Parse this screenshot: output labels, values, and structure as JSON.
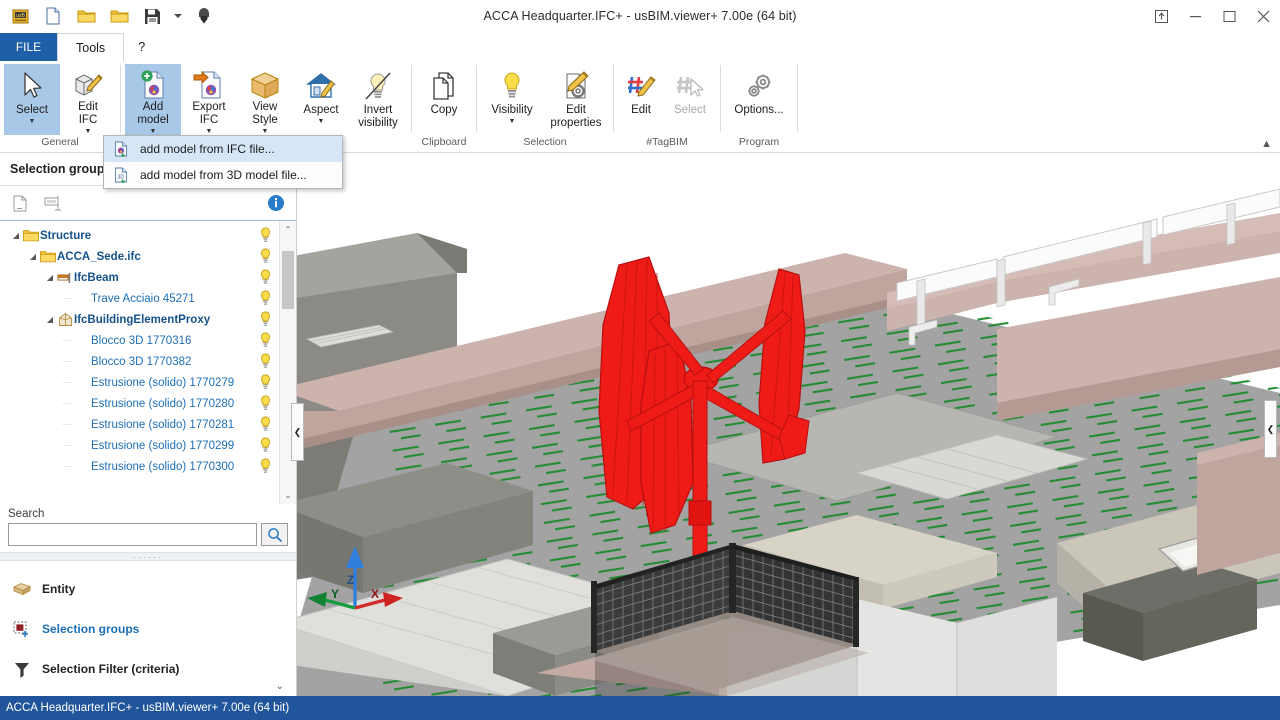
{
  "window": {
    "title": "ACCA Headquarter.IFC+ - usBIM.viewer+  7.00e (64 bit)",
    "restore_label": "❐",
    "minimize_label": "–",
    "maximize_label": "❐",
    "close_label": "✕"
  },
  "quick_access": [
    {
      "name": "app-logo-icon",
      "label": "usBIM"
    },
    {
      "name": "new-file-icon",
      "label": "New"
    },
    {
      "name": "open-folder-icon",
      "label": "Open"
    },
    {
      "name": "recent-folder-icon",
      "label": "Recent"
    },
    {
      "name": "save-icon",
      "label": "Save"
    },
    {
      "name": "save-dropdown-icon",
      "label": "▾"
    },
    {
      "name": "download-icon",
      "label": "Download"
    }
  ],
  "tabs": {
    "file": "FILE",
    "items": [
      {
        "label": "Tools",
        "active": true
      },
      {
        "label": "?",
        "active": false
      }
    ]
  },
  "ribbon": {
    "collapse_label": "▲",
    "groups": [
      {
        "label": "General",
        "buttons": [
          {
            "name": "select-button",
            "label": "Select",
            "icon": "cursor-arrow-icon",
            "caret": true,
            "state": "selected"
          },
          {
            "name": "edit-ifc-button",
            "label": "Edit\nIFC",
            "icon": "edit-ifc-icon",
            "caret": true,
            "state": "normal"
          }
        ]
      },
      {
        "label": "",
        "buttons": [
          {
            "name": "add-model-button",
            "label": "Add\nmodel",
            "icon": "add-model-icon",
            "caret": true,
            "state": "highlighted"
          },
          {
            "name": "export-ifc-button",
            "label": "Export\nIFC",
            "icon": "export-ifc-icon",
            "caret": true,
            "state": "normal"
          },
          {
            "name": "view-style-button",
            "label": "View\nStyle",
            "icon": "cube-icon",
            "caret": true,
            "state": "normal"
          },
          {
            "name": "aspect-button",
            "label": "Aspect",
            "icon": "house-brush-icon",
            "caret": true,
            "state": "normal"
          },
          {
            "name": "invert-visibility-button",
            "label": "Invert\nvisibility",
            "icon": "bulb-crossed-icon",
            "caret": false,
            "state": "normal"
          }
        ]
      },
      {
        "label": "Clipboard",
        "buttons": [
          {
            "name": "copy-button",
            "label": "Copy",
            "icon": "copy-pages-icon",
            "caret": false,
            "state": "normal"
          }
        ]
      },
      {
        "label": "Selection",
        "buttons": [
          {
            "name": "visibility-button",
            "label": "Visibility",
            "icon": "bulb-icon",
            "caret": true,
            "state": "normal"
          },
          {
            "name": "edit-properties-button",
            "label": "Edit\nproperties",
            "icon": "edit-properties-icon",
            "caret": false,
            "state": "normal"
          }
        ]
      },
      {
        "label": "#TagBIM",
        "buttons": [
          {
            "name": "tag-edit-button",
            "label": "Edit",
            "icon": "hash-pencil-icon",
            "caret": false,
            "state": "normal"
          },
          {
            "name": "tag-select-button",
            "label": "Select",
            "icon": "hash-cursor-icon",
            "caret": false,
            "state": "disabled"
          }
        ]
      },
      {
        "label": "Program",
        "buttons": [
          {
            "name": "options-button",
            "label": "Options...",
            "icon": "gears-icon",
            "caret": false,
            "state": "normal"
          }
        ]
      }
    ]
  },
  "add_model_menu": {
    "items": [
      {
        "name": "menu-add-model-from-ifc",
        "label": "add model from IFC file...",
        "icon": "ifc-file-icon",
        "hovered": true
      },
      {
        "name": "menu-add-model-from-3d",
        "label": "add model from 3D model file...",
        "icon": "model3d-file-icon",
        "hovered": false
      }
    ]
  },
  "left_panel": {
    "title": "Selection groups",
    "toolbar": [
      {
        "name": "new-group-icon",
        "label": "New group"
      },
      {
        "name": "rename-group-icon",
        "label": "Rename group"
      },
      {
        "name": "info-icon",
        "label": "Info"
      }
    ],
    "tree": [
      {
        "label": "Structure",
        "indent": 0,
        "icon": "folder-icon",
        "bold": true,
        "expander": "collapse",
        "bulb": true
      },
      {
        "label": "ACCA_Sede.ifc",
        "indent": 1,
        "icon": "folder-icon",
        "bold": true,
        "expander": "collapse",
        "bulb": true
      },
      {
        "label": "IfcBeam",
        "indent": 2,
        "icon": "beam-icon",
        "bold": true,
        "expander": "collapse",
        "bulb": true
      },
      {
        "label": "Trave Acciaio 45271",
        "indent": 3,
        "icon": "none",
        "bold": false,
        "expander": "leaf",
        "bulb": true
      },
      {
        "label": "IfcBuildingElementProxy",
        "indent": 2,
        "icon": "proxy-icon",
        "bold": true,
        "expander": "collapse",
        "bulb": true
      },
      {
        "label": "Blocco 3D 1770316",
        "indent": 3,
        "icon": "none",
        "bold": false,
        "expander": "leaf",
        "bulb": true
      },
      {
        "label": "Blocco 3D 1770382",
        "indent": 3,
        "icon": "none",
        "bold": false,
        "expander": "leaf",
        "bulb": true
      },
      {
        "label": "Estrusione (solido) 1770279",
        "indent": 3,
        "icon": "none",
        "bold": false,
        "expander": "leaf",
        "bulb": true
      },
      {
        "label": "Estrusione (solido) 1770280",
        "indent": 3,
        "icon": "none",
        "bold": false,
        "expander": "leaf",
        "bulb": true
      },
      {
        "label": "Estrusione (solido) 1770281",
        "indent": 3,
        "icon": "none",
        "bold": false,
        "expander": "leaf",
        "bulb": true
      },
      {
        "label": "Estrusione (solido) 1770299",
        "indent": 3,
        "icon": "none",
        "bold": false,
        "expander": "leaf",
        "bulb": true
      },
      {
        "label": "Estrusione (solido) 1770300",
        "indent": 3,
        "icon": "none",
        "bold": false,
        "expander": "leaf",
        "bulb": true
      }
    ],
    "scroll": {
      "up_label": "⌃",
      "down_label": "⌄"
    },
    "search": {
      "label": "Search",
      "value": "",
      "placeholder": "",
      "button_icon": "magnifier-icon"
    },
    "splitter_dots": "······",
    "nav": [
      {
        "name": "nav-entity",
        "label": "Entity",
        "icon": "entity-icon",
        "selected": false
      },
      {
        "name": "nav-selection-groups",
        "label": "Selection groups",
        "icon": "selection-groups-icon",
        "selected": true
      },
      {
        "name": "nav-selection-filter",
        "label": "Selection Filter (criteria)",
        "icon": "funnel-icon",
        "selected": false
      }
    ],
    "more_label": "⌄",
    "collapse_left_label": "❮",
    "collapse_right_label": "❮"
  },
  "viewport": {
    "axis_gizmo": {
      "x_label": "X",
      "y_label": "Y",
      "z_label": "Z",
      "x_color": "#d42b2b",
      "y_color": "#169b3e",
      "z_color": "#2f7fdb"
    },
    "colors": {
      "background": "#ffffff",
      "floor_gray": "#a0a0a0",
      "wall_pink": "#c7aca6",
      "concrete": "#cfcac0",
      "selection_red": "#ee1b17",
      "grass_green": "#1d8b2d",
      "dark_metal": "#3b3b3b"
    }
  },
  "statusbar": {
    "text": "ACCA Headquarter.IFC+ - usBIM.viewer+  7.00e (64 bit)"
  }
}
